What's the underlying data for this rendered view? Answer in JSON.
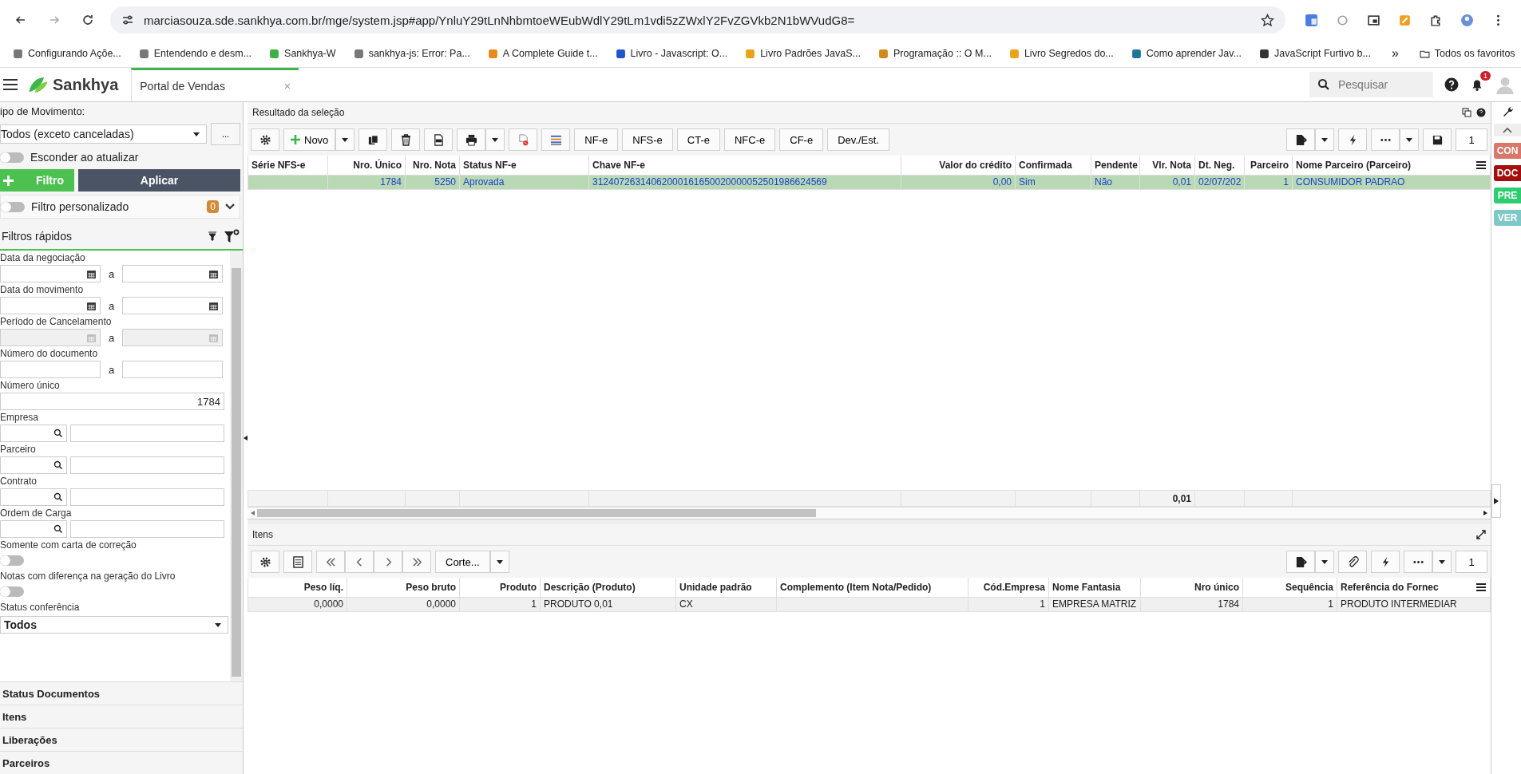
{
  "browser": {
    "url": "marciasouza.sde.sankhya.com.br/mge/system.jsp#app/YnluY29tLnNhbmtoeWEubWdlY29tLm1vdi5zZWxlY2FvZGVkb2N1bWVudG8=",
    "bookmarks": [
      "Configurando Açõe...",
      "Entendendo e desm...",
      "Sankhya-W",
      "sankhya-js: Error: Pa...",
      "A Complete Guide t...",
      "Livro - Javascript: O...",
      "Livro Padrões JavaS...",
      "Programação :: O M...",
      "Livro Segredos do...",
      "Como aprender Jav...",
      "JavaScript Furtivo b..."
    ],
    "more": "»",
    "folder": "Todos os favoritos"
  },
  "app": {
    "brand": "Sankhya",
    "tab": "Portal de Vendas",
    "close": "×",
    "search": {
      "placeholder": "Pesquisar"
    },
    "notifications": "1"
  },
  "filters": {
    "tipo_label": "ipo de Movimento:",
    "tipo_value": "Todos (exceto canceladas)",
    "more": "...",
    "hide_label": "Esconder ao atualizar",
    "hide_on": false,
    "add_filter": "Filtro",
    "apply": "Aplicar",
    "custom_label": "Filtro personalizado",
    "custom_on": false,
    "custom_count": "0",
    "quick_title": "Filtros rápidos",
    "fields": [
      {
        "kind": "date-range",
        "label": "Data da negociação",
        "sep": "a",
        "disabled": false
      },
      {
        "kind": "date-range",
        "label": "Data do movimento",
        "sep": "a",
        "disabled": false
      },
      {
        "kind": "date-range",
        "label": "Período de Cancelamento",
        "sep": "a",
        "disabled": true
      },
      {
        "kind": "text-range",
        "label": "Número do documento",
        "sep": "a"
      },
      {
        "kind": "number",
        "label": "Número único",
        "value": "1784"
      },
      {
        "kind": "lookup",
        "label": "Empresa"
      },
      {
        "kind": "lookup",
        "label": "Parceiro"
      },
      {
        "kind": "lookup",
        "label": "Contrato"
      },
      {
        "kind": "lookup",
        "label": "Ordem de Carga"
      },
      {
        "kind": "toggle",
        "label": "Somente com carta de correção",
        "on": false
      },
      {
        "kind": "toggle",
        "label": "Notas com diferença na geração do Livro",
        "on": false
      },
      {
        "kind": "select",
        "label": "Status conferência",
        "value": "Todos"
      }
    ],
    "sections": [
      "Status Documentos",
      "Itens",
      "Liberações",
      "Parceiros"
    ]
  },
  "result": {
    "title": "Resultado da seleção",
    "new": "Novo",
    "doc_buttons": [
      "NF-e",
      "NFS-e",
      "CT-e",
      "NFC-e",
      "CF-e",
      "Dev./Est."
    ],
    "page": "1",
    "columns": [
      {
        "label": "Série NFS-e"
      },
      {
        "label": "Nro. Único"
      },
      {
        "label": "Nro. Nota"
      },
      {
        "label": "Status NF-e"
      },
      {
        "label": "Chave NF-e"
      },
      {
        "label": "Valor do crédito"
      },
      {
        "label": "Confirmada"
      },
      {
        "label": "Pendente"
      },
      {
        "label": "Vlr. Nota",
        "total": "0,01"
      },
      {
        "label": "Dt. Neg."
      },
      {
        "label": "Parceiro"
      },
      {
        "label": "Nome Parceiro (Parceiro)"
      }
    ],
    "rows": [
      {
        "selected": true,
        "cells": [
          "",
          "1784",
          "5250",
          "Aprovada",
          "31240726314062000161650020000052501986624569",
          "0,00",
          "Sim",
          "Não",
          "0,01",
          "02/07/202",
          "1",
          "CONSUMIDOR PADRAO"
        ]
      }
    ]
  },
  "items": {
    "title": "Itens",
    "cut": "Corte...",
    "page": "1",
    "columns": [
      {
        "label": "Peso líq."
      },
      {
        "label": "Peso bruto"
      },
      {
        "label": "Produto"
      },
      {
        "label": "Descrição (Produto)"
      },
      {
        "label": "Unidade padrão"
      },
      {
        "label": "Complemento (Item Nota/Pedido)"
      },
      {
        "label": "Cód.Empresa"
      },
      {
        "label": "Nome Fantasia"
      },
      {
        "label": "Nro único"
      },
      {
        "label": "Sequência"
      },
      {
        "label": "Referência do Fornec"
      }
    ],
    "rows": [
      {
        "selected": false,
        "cells": [
          "0,0000",
          "0,0000",
          "1",
          "PRODUTO 0,01",
          "CX",
          "",
          "1",
          "EMPRESA MATRIZ",
          "1784",
          "1",
          "PRODUTO INTERMEDIAR"
        ]
      }
    ]
  },
  "side_tags": [
    {
      "label": "CON",
      "color": "#d9776b"
    },
    {
      "label": "DOC",
      "color": "#a30f0f"
    },
    {
      "label": "PRE",
      "color": "#2ecc71"
    },
    {
      "label": "VER",
      "color": "#7fc8c8"
    }
  ]
}
